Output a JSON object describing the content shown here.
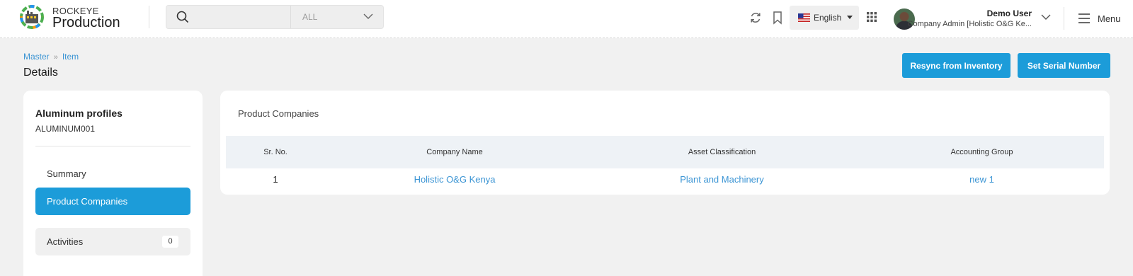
{
  "brand": {
    "top": "ROCKEYE",
    "bottom": "Production"
  },
  "search": {
    "placeholder": "",
    "scope": "ALL"
  },
  "header": {
    "language": "English",
    "user_name": "Demo User",
    "user_role": "Company Admin [Holistic O&G Ke...",
    "menu_label": "Menu"
  },
  "breadcrumb": [
    "Master",
    "Item"
  ],
  "page_title": "Details",
  "actions": {
    "resync": "Resync from Inventory",
    "serial": "Set Serial Number"
  },
  "item": {
    "name": "Aluminum profiles",
    "code": "ALUMINUM001"
  },
  "nav": [
    {
      "label": "Summary"
    },
    {
      "label": "Product Companies",
      "active": true
    },
    {
      "label": "Activities",
      "count": "0"
    }
  ],
  "section": {
    "title": "Product Companies",
    "columns": [
      "Sr. No.",
      "Company Name",
      "Asset Classification",
      "Accounting Group"
    ],
    "rows": [
      [
        "1",
        "Holistic O&G Kenya",
        "Plant and Machinery",
        "new 1"
      ]
    ]
  },
  "colors": {
    "accent": "#1c9cd9",
    "link": "#3c95d4",
    "page_bg": "#f1f1f1"
  }
}
